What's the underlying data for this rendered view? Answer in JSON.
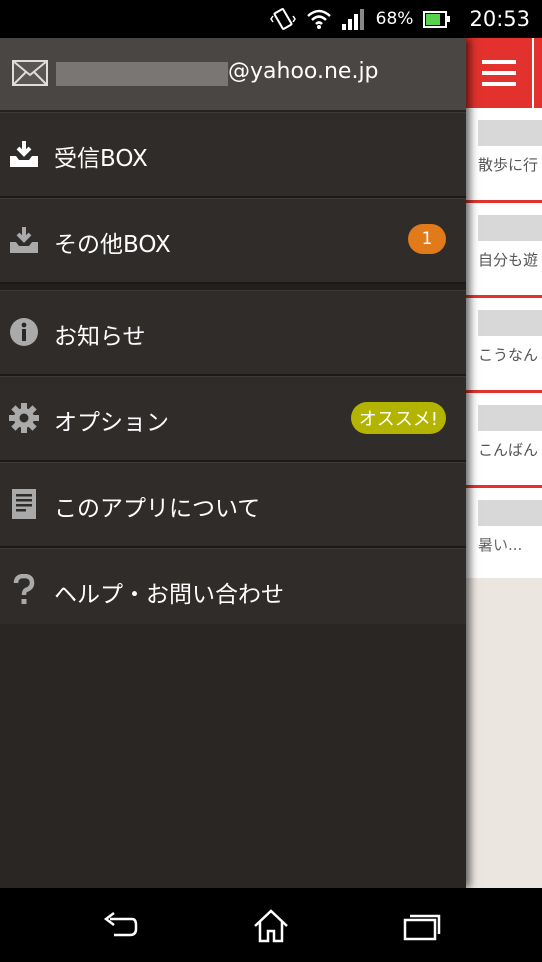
{
  "status_bar": {
    "battery": "68%",
    "time": "20:53"
  },
  "drawer": {
    "account": {
      "email_domain": "@yahoo.ne.jp"
    },
    "items": [
      {
        "label": "受信BOX",
        "icon": "inbox-download-icon"
      },
      {
        "label": "その他BOX",
        "icon": "tray-download-icon",
        "badge": "1"
      },
      {
        "label": "お知らせ",
        "icon": "info-icon"
      },
      {
        "label": "オプション",
        "icon": "gear-icon",
        "badge": "オススメ!"
      },
      {
        "label": "このアプリについて",
        "icon": "document-icon"
      },
      {
        "label": "ヘルプ・お問い合わせ",
        "icon": "question-icon"
      }
    ]
  },
  "content": {
    "messages": [
      {
        "snippet": "散歩に行"
      },
      {
        "snippet": "自分も遊"
      },
      {
        "snippet": "こうなん"
      },
      {
        "snippet": "こんばん"
      },
      {
        "snippet": "暑い..."
      }
    ]
  },
  "colors": {
    "accent": "#e3322d",
    "badge_orange": "#e07a1a",
    "badge_green": "#b2b400"
  }
}
